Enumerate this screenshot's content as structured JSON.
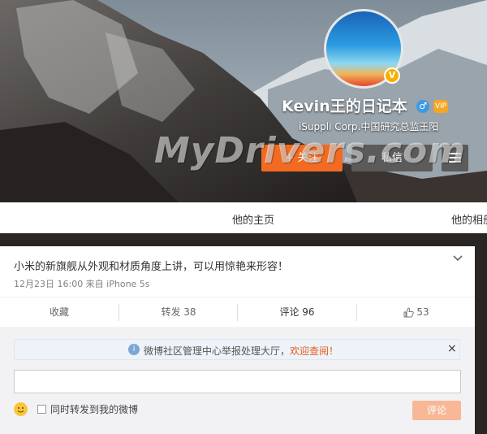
{
  "profile": {
    "name": "Kevin王的日记本",
    "description": "iSuppli Corp.中国研究总监王阳",
    "verified_badge": "V",
    "gender_icon": "male-icon",
    "level_badge": "VIP"
  },
  "buttons": {
    "follow": "+ 关注",
    "message": "私信",
    "menu_icon": "menu-icon"
  },
  "nav": {
    "home_tab": "他的主页",
    "album_tab": "他的相册"
  },
  "post": {
    "text": "小米的新旗舰从外观和材质角度上讲，可以用惊艳来形容！",
    "meta": "12月23日 16:00 来自 iPhone 5s",
    "actions": {
      "favorite": "收藏",
      "repost": "转发 38",
      "comment": "评论 96",
      "like": "53"
    }
  },
  "comment_box": {
    "notice_prefix": "微博社区管理中心举报处理大厅，",
    "notice_link": "欢迎查阅！",
    "close": "×",
    "repost_label": "同时转发到我的微博",
    "submit": "评论"
  },
  "watermark": "MyDrivers.com",
  "colors": {
    "accent": "#f36b22",
    "dark_button": "#5b5b5b",
    "link_orange": "#e8591a"
  }
}
